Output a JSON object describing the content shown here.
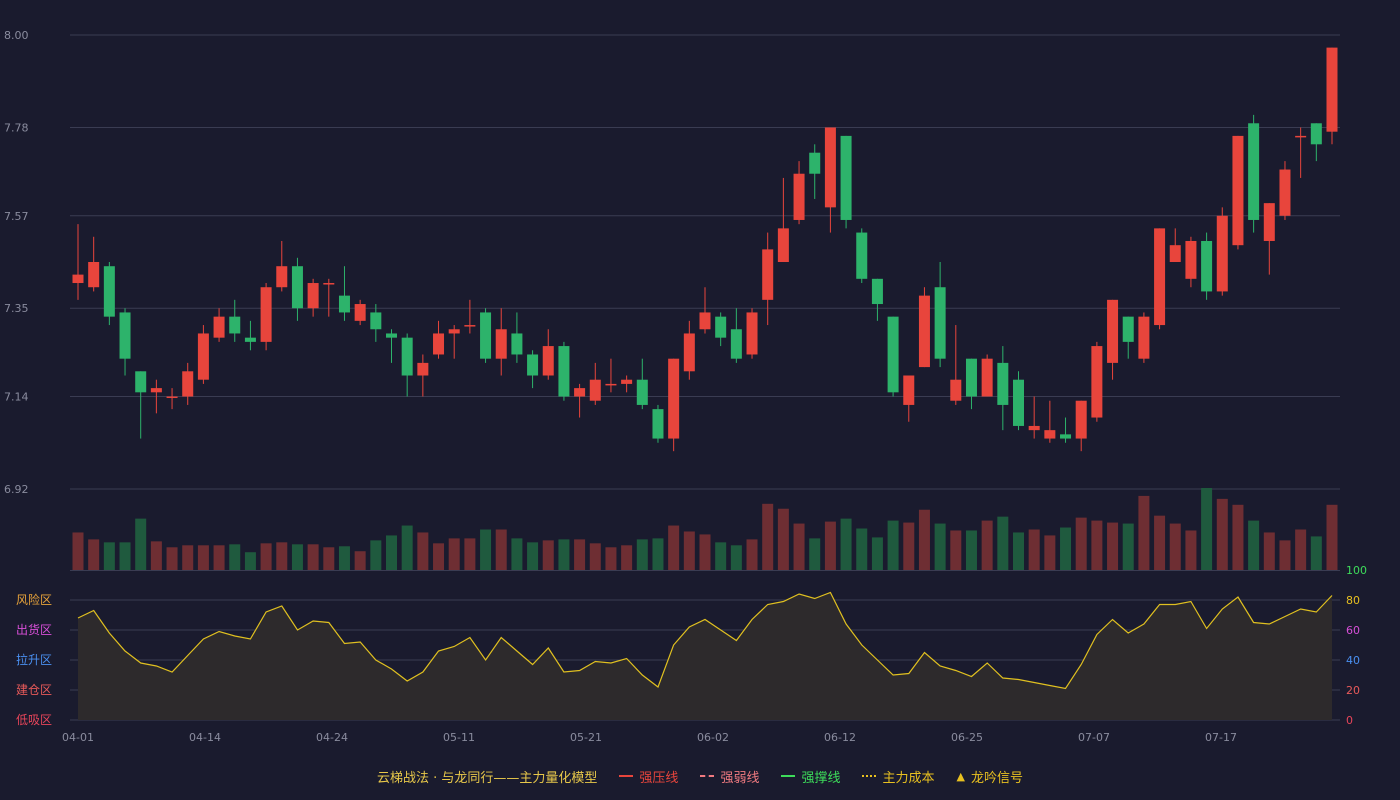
{
  "chart_data": {
    "type": "candlestick",
    "colors": {
      "up": "#e8453c",
      "down": "#2db36b",
      "indicator_line": "#e0c020",
      "grid": "#3a3c52",
      "axis_text": "#8a8c9e"
    },
    "price_axis": {
      "ticks": [
        "8.00",
        "7.78",
        "7.57",
        "7.35",
        "7.14",
        "6.92"
      ],
      "range": [
        6.92,
        8.0
      ]
    },
    "x_labels": [
      "04-01",
      "04-14",
      "04-24",
      "05-11",
      "05-21",
      "06-02",
      "06-12",
      "06-25",
      "07-07",
      "07-17"
    ],
    "candles": [
      [
        7.41,
        7.43,
        7.37,
        7.55
      ],
      [
        7.4,
        7.46,
        7.39,
        7.52
      ],
      [
        7.45,
        7.33,
        7.31,
        7.46
      ],
      [
        7.34,
        7.23,
        7.19,
        7.35
      ],
      [
        7.2,
        7.15,
        7.04,
        7.2
      ],
      [
        7.15,
        7.16,
        7.1,
        7.18
      ],
      [
        7.14,
        7.14,
        7.11,
        7.16
      ],
      [
        7.14,
        7.2,
        7.12,
        7.22
      ],
      [
        7.18,
        7.29,
        7.17,
        7.31
      ],
      [
        7.28,
        7.33,
        7.27,
        7.35
      ],
      [
        7.33,
        7.29,
        7.27,
        7.37
      ],
      [
        7.28,
        7.27,
        7.25,
        7.32
      ],
      [
        7.27,
        7.4,
        7.25,
        7.41
      ],
      [
        7.4,
        7.45,
        7.39,
        7.51
      ],
      [
        7.45,
        7.35,
        7.32,
        7.47
      ],
      [
        7.35,
        7.41,
        7.33,
        7.42
      ],
      [
        7.41,
        7.41,
        7.33,
        7.42
      ],
      [
        7.38,
        7.34,
        7.32,
        7.45
      ],
      [
        7.32,
        7.36,
        7.31,
        7.37
      ],
      [
        7.34,
        7.3,
        7.27,
        7.36
      ],
      [
        7.29,
        7.28,
        7.22,
        7.3
      ],
      [
        7.28,
        7.19,
        7.14,
        7.29
      ],
      [
        7.19,
        7.22,
        7.14,
        7.24
      ],
      [
        7.24,
        7.29,
        7.23,
        7.32
      ],
      [
        7.29,
        7.3,
        7.23,
        7.31
      ],
      [
        7.31,
        7.31,
        7.29,
        7.37
      ],
      [
        7.34,
        7.23,
        7.22,
        7.35
      ],
      [
        7.23,
        7.3,
        7.19,
        7.35
      ],
      [
        7.29,
        7.24,
        7.22,
        7.34
      ],
      [
        7.24,
        7.19,
        7.16,
        7.25
      ],
      [
        7.19,
        7.26,
        7.18,
        7.3
      ],
      [
        7.26,
        7.14,
        7.13,
        7.27
      ],
      [
        7.14,
        7.16,
        7.09,
        7.17
      ],
      [
        7.13,
        7.18,
        7.12,
        7.22
      ],
      [
        7.17,
        7.17,
        7.15,
        7.23
      ],
      [
        7.17,
        7.18,
        7.15,
        7.19
      ],
      [
        7.18,
        7.12,
        7.11,
        7.23
      ],
      [
        7.11,
        7.04,
        7.03,
        7.12
      ],
      [
        7.04,
        7.23,
        7.01,
        7.23
      ],
      [
        7.2,
        7.29,
        7.18,
        7.32
      ],
      [
        7.3,
        7.34,
        7.29,
        7.4
      ],
      [
        7.33,
        7.28,
        7.26,
        7.34
      ],
      [
        7.3,
        7.23,
        7.22,
        7.35
      ],
      [
        7.24,
        7.34,
        7.23,
        7.35
      ],
      [
        7.37,
        7.49,
        7.31,
        7.53
      ],
      [
        7.46,
        7.54,
        7.46,
        7.66
      ],
      [
        7.56,
        7.67,
        7.55,
        7.7
      ],
      [
        7.72,
        7.67,
        7.61,
        7.74
      ],
      [
        7.59,
        7.78,
        7.53,
        7.78
      ],
      [
        7.76,
        7.56,
        7.54,
        7.76
      ],
      [
        7.53,
        7.42,
        7.41,
        7.54
      ],
      [
        7.42,
        7.36,
        7.32,
        7.42
      ],
      [
        7.33,
        7.15,
        7.14,
        7.33
      ],
      [
        7.12,
        7.19,
        7.08,
        7.19
      ],
      [
        7.21,
        7.38,
        7.21,
        7.4
      ],
      [
        7.4,
        7.23,
        7.21,
        7.46
      ],
      [
        7.13,
        7.18,
        7.12,
        7.31
      ],
      [
        7.23,
        7.14,
        7.11,
        7.23
      ],
      [
        7.14,
        7.23,
        7.14,
        7.24
      ],
      [
        7.22,
        7.12,
        7.06,
        7.26
      ],
      [
        7.18,
        7.07,
        7.06,
        7.2
      ],
      [
        7.06,
        7.07,
        7.04,
        7.14
      ],
      [
        7.04,
        7.06,
        7.03,
        7.13
      ],
      [
        7.05,
        7.04,
        7.03,
        7.09
      ],
      [
        7.04,
        7.13,
        7.01,
        7.13
      ],
      [
        7.09,
        7.26,
        7.08,
        7.27
      ],
      [
        7.22,
        7.37,
        7.18,
        7.37
      ],
      [
        7.33,
        7.27,
        7.23,
        7.33
      ],
      [
        7.23,
        7.33,
        7.22,
        7.34
      ],
      [
        7.31,
        7.54,
        7.3,
        7.54
      ],
      [
        7.46,
        7.5,
        7.46,
        7.54
      ],
      [
        7.42,
        7.51,
        7.4,
        7.52
      ],
      [
        7.51,
        7.39,
        7.37,
        7.53
      ],
      [
        7.39,
        7.57,
        7.38,
        7.59
      ],
      [
        7.5,
        7.76,
        7.49,
        7.76
      ],
      [
        7.79,
        7.56,
        7.53,
        7.81
      ],
      [
        7.51,
        7.6,
        7.43,
        7.6
      ],
      [
        7.57,
        7.68,
        7.56,
        7.7
      ],
      [
        7.76,
        7.76,
        7.66,
        7.78
      ],
      [
        7.79,
        7.74,
        7.7,
        7.79
      ],
      [
        7.77,
        7.97,
        7.74,
        7.97
      ]
    ],
    "volume": [
      38,
      31,
      28,
      28,
      52,
      29,
      23,
      25,
      25,
      25,
      26,
      18,
      27,
      28,
      26,
      26,
      23,
      24,
      19,
      30,
      35,
      45,
      38,
      27,
      32,
      32,
      41,
      41,
      32,
      28,
      30,
      31,
      31,
      27,
      23,
      25,
      31,
      32,
      45,
      39,
      36,
      28,
      25,
      31,
      67,
      62,
      47,
      32,
      49,
      52,
      42,
      33,
      50,
      48,
      61,
      47,
      40,
      40,
      50,
      54,
      38,
      41,
      35,
      43,
      53,
      50,
      48,
      47,
      75,
      55,
      47,
      40,
      83,
      72,
      66,
      50,
      38,
      30,
      41,
      34,
      66
    ],
    "indicator": {
      "left_zone_labels": [
        "风险区",
        "出货区",
        "拉升区",
        "建仓区",
        "低吸区"
      ],
      "right_ticks": [
        "100",
        "80",
        "60",
        "40",
        "20",
        "0"
      ],
      "range": [
        0,
        100
      ],
      "values": [
        68,
        73,
        58,
        46,
        38,
        36,
        32,
        43,
        54,
        59,
        56,
        54,
        72,
        76,
        60,
        66,
        65,
        51,
        52,
        40,
        34,
        26,
        32,
        46,
        49,
        55,
        40,
        55,
        46,
        37,
        48,
        32,
        33,
        39,
        38,
        41,
        30,
        22,
        50,
        62,
        67,
        60,
        53,
        67,
        77,
        79,
        84,
        81,
        85,
        64,
        50,
        40,
        30,
        31,
        45,
        36,
        33,
        29,
        38,
        28,
        27,
        25,
        23,
        21,
        37,
        57,
        67,
        58,
        64,
        77,
        77,
        79,
        61,
        74,
        82,
        65,
        64,
        69,
        74,
        72,
        83
      ]
    }
  },
  "legend": {
    "items": [
      {
        "label": "云梯战法 · 与龙同行——主力量化模型",
        "color": "#e8c84a",
        "icon": "none"
      },
      {
        "label": "强压线",
        "color": "#e8453c",
        "icon": "solid-line"
      },
      {
        "label": "强弱线",
        "color": "#f07a80",
        "icon": "dashed-line"
      },
      {
        "label": "强撑线",
        "color": "#3ddc5a",
        "icon": "solid-line"
      },
      {
        "label": "主力成本",
        "color": "#e8c020",
        "icon": "dotted-line"
      },
      {
        "label": "龙吟信号",
        "color": "#e8c020",
        "icon": "triangle-icon"
      }
    ]
  }
}
